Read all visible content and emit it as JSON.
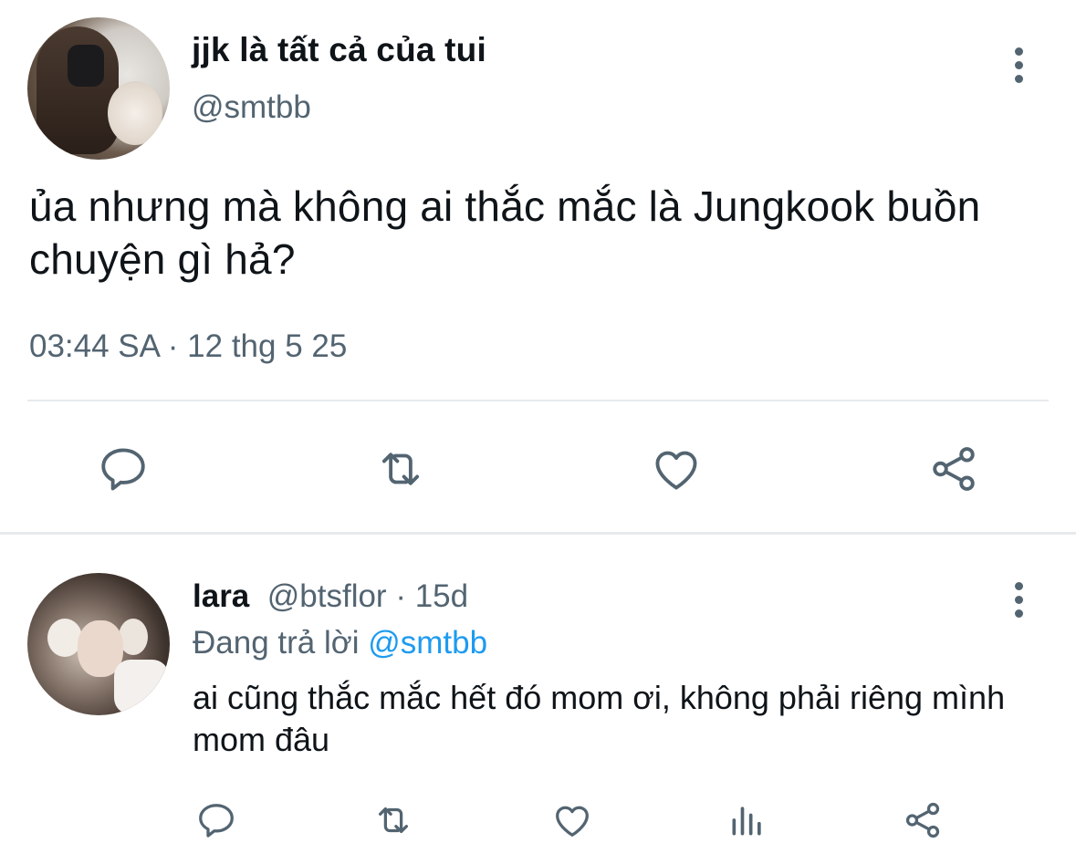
{
  "tweet": {
    "display_name": "jjk là tất cả của tui",
    "handle": "@smtbb",
    "text": "ủa nhưng mà không ai thắc mắc là Jungkook buồn chuyện gì hả?",
    "timestamp": "03:44 SA · 12 thg 5 25",
    "actions": [
      "comment-icon",
      "retweet-icon",
      "like-icon",
      "share-icon"
    ],
    "more_icon": "more-vertical-icon"
  },
  "reply": {
    "display_name": "lara",
    "handle": "@btsflor",
    "separator": " · ",
    "age": "15d",
    "replying_prefix": "Đang trả lời",
    "replying_to": "@smtbb",
    "text": "ai cũng thắc mắc hết đó mom ơi, không phải riêng mình mom đâu",
    "actions": [
      "comment-icon",
      "retweet-icon",
      "like-icon",
      "views-icon",
      "share-icon"
    ],
    "more_icon": "more-vertical-icon"
  },
  "colors": {
    "text_primary": "#0f1419",
    "text_secondary": "#536471",
    "link": "#1d9bf0",
    "divider": "#e7eaed"
  }
}
